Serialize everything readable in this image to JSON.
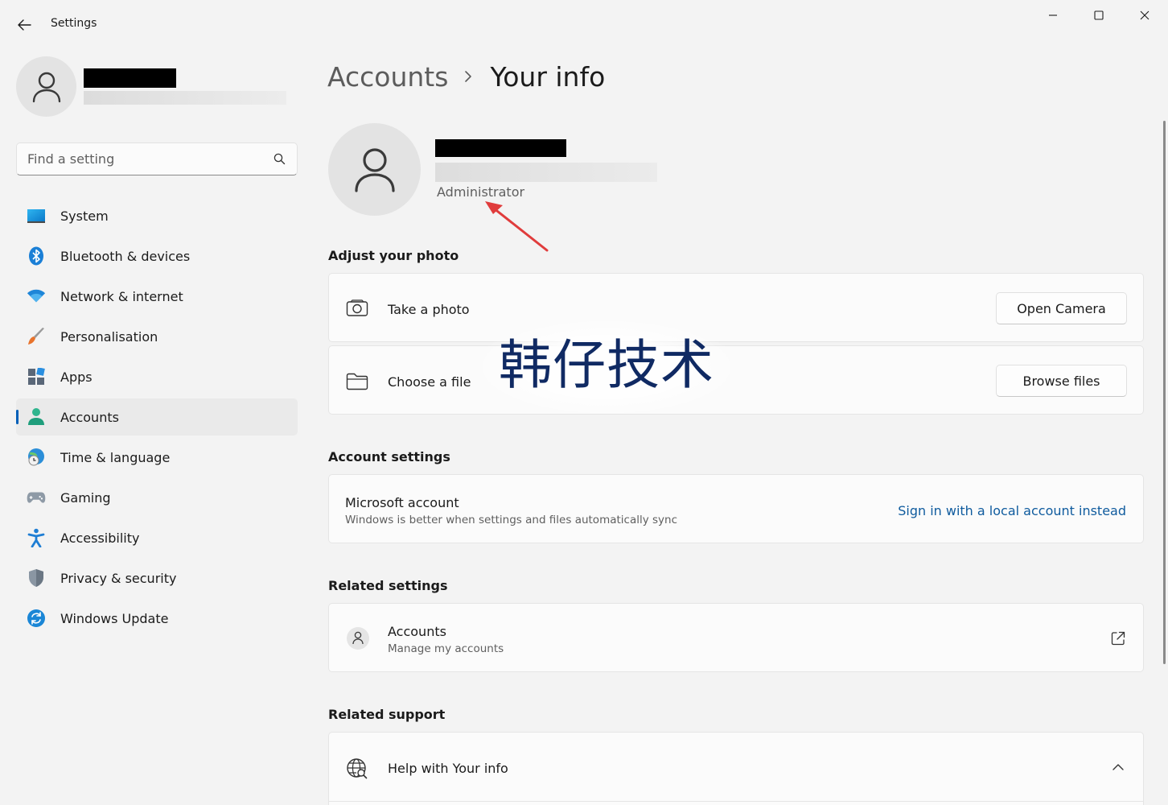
{
  "window": {
    "title": "Settings",
    "back_icon": "arrow-left-icon",
    "controls": [
      "minimize-icon",
      "maximize-icon",
      "close-icon"
    ]
  },
  "sidebar": {
    "profile": {
      "avatar_icon": "person-icon",
      "name": "",
      "email": ""
    },
    "search": {
      "placeholder": "Find a setting",
      "value": "",
      "icon": "search-icon"
    },
    "items": [
      {
        "label": "System",
        "icon": "system-display-icon",
        "active": false
      },
      {
        "label": "Bluetooth & devices",
        "icon": "bluetooth-icon",
        "active": false
      },
      {
        "label": "Network & internet",
        "icon": "wifi-icon",
        "active": false
      },
      {
        "label": "Personalisation",
        "icon": "paintbrush-icon",
        "active": false
      },
      {
        "label": "Apps",
        "icon": "apps-icon",
        "active": false
      },
      {
        "label": "Accounts",
        "icon": "accounts-person-icon",
        "active": true
      },
      {
        "label": "Time & language",
        "icon": "globe-clock-icon",
        "active": false
      },
      {
        "label": "Gaming",
        "icon": "gamepad-icon",
        "active": false
      },
      {
        "label": "Accessibility",
        "icon": "accessibility-icon",
        "active": false
      },
      {
        "label": "Privacy & security",
        "icon": "shield-icon",
        "active": false
      },
      {
        "label": "Windows Update",
        "icon": "update-icon",
        "active": false
      }
    ]
  },
  "main": {
    "breadcrumb": {
      "parent": "Accounts",
      "current": "Your info"
    },
    "user": {
      "role": "Administrator"
    },
    "adjust_photo": {
      "title": "Adjust your photo",
      "take_photo": {
        "label": "Take a photo",
        "button": "Open Camera",
        "icon": "camera-icon"
      },
      "choose_file": {
        "label": "Choose a file",
        "button": "Browse files",
        "icon": "folder-icon"
      }
    },
    "account_settings": {
      "title": "Account settings",
      "microsoft_account": {
        "title": "Microsoft account",
        "subtitle": "Windows is better when settings and files automatically sync",
        "link": "Sign in with a local account instead"
      }
    },
    "related_settings": {
      "title": "Related settings",
      "accounts": {
        "title": "Accounts",
        "subtitle": "Manage my accounts",
        "icon": "external-link-icon"
      }
    },
    "related_support": {
      "title": "Related support",
      "help": {
        "label": "Help with Your info",
        "icon": "globe-search-icon"
      }
    },
    "watermark": "韩仔技术"
  },
  "colors": {
    "background": "#f3f3f3",
    "card": "#fbfbfb",
    "accent": "#005fb8",
    "link": "#0f5b9e",
    "annotation_arrow": "#e03c3c",
    "watermark": "#102a63"
  }
}
